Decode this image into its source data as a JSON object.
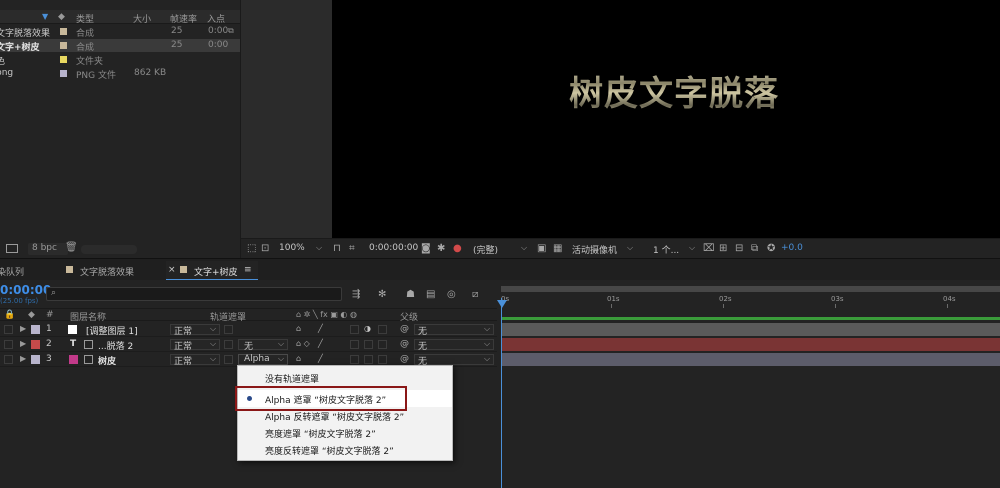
{
  "project": {
    "headers": {
      "type": "类型",
      "size": "大小",
      "fps": "帧速率",
      "in": "入点"
    },
    "items": [
      {
        "name": "文字脱落效果",
        "type": "合成",
        "size": "",
        "fps": "25",
        "in": "0:00",
        "swatch": "#c8b89a"
      },
      {
        "name": "文字+树皮",
        "type": "合成",
        "size": "",
        "fps": "25",
        "in": "0:00",
        "swatch": "#c8b89a"
      },
      {
        "name": "色",
        "type": "文件夹",
        "size": "",
        "fps": "",
        "in": "",
        "swatch": "#e8d860"
      },
      {
        "name": "png",
        "type": "PNG 文件",
        "size": "862 KB",
        "fps": "",
        "in": "",
        "swatch": "#b8b4cc"
      }
    ],
    "bpc": "8 bpc"
  },
  "viewer": {
    "comp_text": "树皮文字脱落",
    "zoom": "100%",
    "timecode": "0:00:00:00",
    "resolution": "(完整)",
    "camera": "活动摄像机",
    "views": "1 个...",
    "exposure": "+0.0"
  },
  "tabs": [
    {
      "label": "渲染队列"
    },
    {
      "label": "文字脱落效果"
    },
    {
      "label": "文字+树皮"
    }
  ],
  "timeline": {
    "time": "0:00:00",
    "fps": "(25.00 fps)",
    "columns": {
      "num": "#",
      "name": "图层名称",
      "trkmat": "轨道遮罩",
      "parent": "父级"
    },
    "ruler_ticks": [
      "0s",
      "01s",
      "02s",
      "03s",
      "04s"
    ],
    "layers": [
      {
        "num": "1",
        "name": "[调整图层 1]",
        "mode": "正常",
        "trkmat": "",
        "parent": "无",
        "color": "#b8b4cc",
        "track": "#5a5a5a"
      },
      {
        "num": "2",
        "name": "...脱落 2",
        "mode": "正常",
        "trkmat": "无",
        "parent": "无",
        "color": "#c44a4a",
        "track": "#7a3434"
      },
      {
        "num": "3",
        "name": "树皮",
        "mode": "正常",
        "trkmat": "Alpha",
        "parent": "无",
        "color": "#b8b4cc",
        "track": "#5c5c6a"
      }
    ]
  },
  "menu": {
    "items": [
      {
        "label": "没有轨道遮罩",
        "checked": false
      },
      {
        "label": "Alpha 遮罩 “树皮文字脱落 2”",
        "checked": true
      },
      {
        "label": "Alpha 反转遮罩 “树皮文字脱落 2”",
        "checked": false
      },
      {
        "label": "亮度遮罩 “树皮文字脱落 2”",
        "checked": false
      },
      {
        "label": "亮度反转遮罩 “树皮文字脱落 2”",
        "checked": false
      }
    ]
  }
}
